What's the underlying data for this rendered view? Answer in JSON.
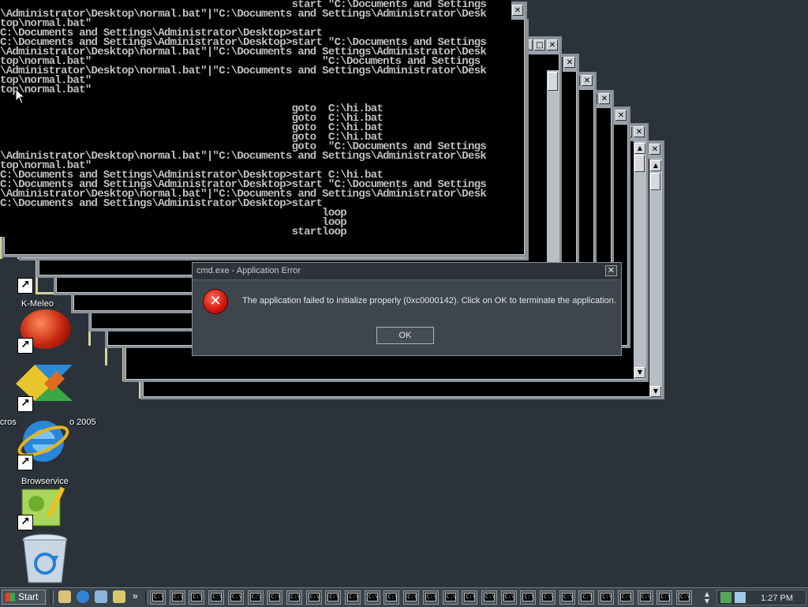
{
  "console": {
    "lines": [
      "                                                start \"C:\\Documents and Settings",
      "\\Administrator\\Desktop\\normal.bat\"|\"C:\\Documents and Settings\\Administrator\\Desk",
      "top\\normal.bat\"",
      "C:\\Documents and Settings\\Administrator\\Desktop>start",
      "C:\\Documents and Settings\\Administrator\\Desktop>start \"C:\\Documents and Settings",
      "\\Administrator\\Desktop\\normal.bat\"|\"C:\\Documents and Settings\\Administrator\\Desk",
      "top\\normal.bat\"                                      \"C:\\Documents and Settings",
      "\\Administrator\\Desktop\\normal.bat\"|\"C:\\Documents and Settings\\Administrator\\Desk",
      "top\\normal.bat\"",
      "top\\normal.bat\"",
      "",
      "                                                goto  C:\\hi.bat",
      "                                                goto  C:\\hi.bat",
      "                                                goto  C:\\hi.bat",
      "                                                goto  C:\\hi.bat",
      "                                                goto  \"C:\\Documents and Settings",
      "\\Administrator\\Desktop\\normal.bat\"|\"C:\\Documents and Settings\\Administrator\\Desk",
      "top\\normal.bat\"",
      "C:\\Documents and Settings\\Administrator\\Desktop>start C:\\hi.bat",
      "C:\\Documents and Settings\\Administrator\\Desktop>start \"C:\\Documents and Settings",
      "\\Administrator\\Desktop\\normal.bat\"|\"C:\\Documents and Settings\\Administrator\\Desk",
      "C:\\Documents and Settings\\Administrator\\Desktop>start",
      "                                                     loop",
      "                                                     loop",
      "                                                startloop"
    ]
  },
  "desktop_icons": {
    "kmeleo_label": "K-Meleo",
    "vs_label_left": "cros",
    "vs_label_right": "o 2005",
    "browservice_label": "Browservice"
  },
  "dialog": {
    "title": "cmd.exe - Application Error",
    "message": "The application failed to initialize properly (0xc0000142). Click on OK to terminate the application.",
    "ok_label": "OK",
    "close_glyph": "✕",
    "error_glyph": "✕"
  },
  "taskbar": {
    "start_label": "Start",
    "overflow_glyph": "»",
    "task_glyph": "C:\\",
    "clock": "1:27 PM"
  },
  "window_buttons": {
    "minimize": "_",
    "maximize": "□",
    "close": "✕"
  },
  "colors": {
    "desktop": "#2b323a",
    "console_text": "#c0c0c0",
    "dialog_bg": "#3e454d",
    "error_red": "#d1150b"
  }
}
